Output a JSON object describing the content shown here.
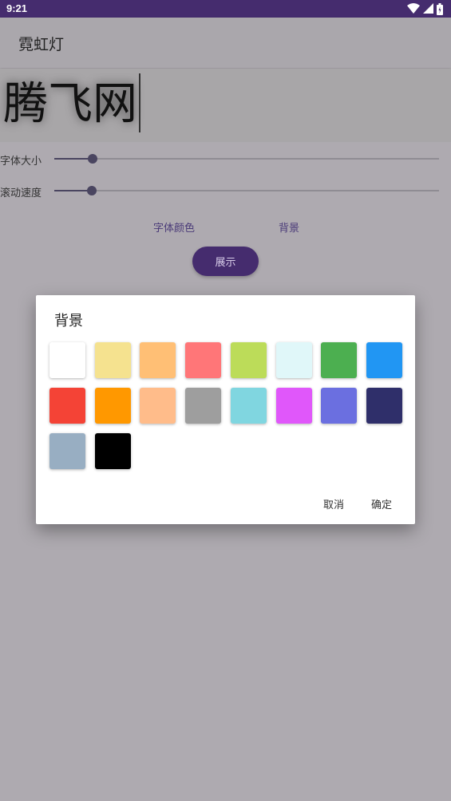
{
  "status_bar": {
    "time": "9:21",
    "icons": [
      "wifi-icon",
      "cellular-signal-icon",
      "battery-icon"
    ]
  },
  "app_bar": {
    "title": "霓虹灯"
  },
  "preview": {
    "text": "腾飞网"
  },
  "sliders": [
    {
      "label": "字体大小",
      "fraction": 0.1
    },
    {
      "label": "滚动速度",
      "fraction": 0.098
    }
  ],
  "actions": {
    "font_color": "字体颜色",
    "background": "背景",
    "show": "展示"
  },
  "dialog": {
    "title": "背景",
    "cancel": "取消",
    "confirm": "确定",
    "swatches": [
      "#ffffff",
      "#f5e28f",
      "#ffbf75",
      "#ff7678",
      "#bcdc59",
      "#e0f7f9",
      "#4caf50",
      "#2196f3",
      "#f44336",
      "#ff9800",
      "#ffbc8a",
      "#9e9e9e",
      "#80d6e0",
      "#e057fa",
      "#6b6fe0",
      "#2f2f6a",
      "#98aec2",
      "#000000"
    ]
  },
  "colors": {
    "primary": "#452c6e",
    "overlay_background": "#aeaab0"
  }
}
